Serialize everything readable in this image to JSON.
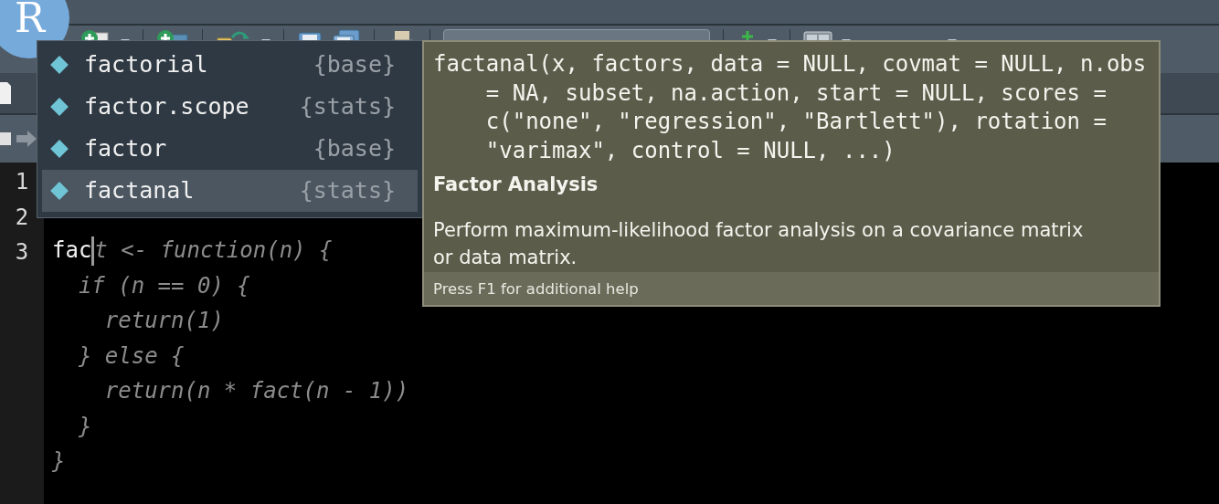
{
  "app": {
    "logo": "R"
  },
  "editor": {
    "lines": [
      {
        "number": "1"
      },
      {
        "number": "2"
      },
      {
        "number": "3",
        "typed": "fac",
        "rest": "t <- function(n) {",
        "cursor": true
      },
      {
        "rest": "  if (n == 0) {"
      },
      {
        "rest": "    return(1)"
      },
      {
        "rest": "  } else {"
      },
      {
        "rest": "    return(n * fact(n - 1))"
      },
      {
        "rest": "  }"
      },
      {
        "rest": "}"
      }
    ]
  },
  "completions": [
    {
      "name": "factorial",
      "package": "{base}",
      "selected": false
    },
    {
      "name": "factor.scope",
      "package": "{stats}",
      "selected": false
    },
    {
      "name": "factor",
      "package": "{base}",
      "selected": false
    },
    {
      "name": "factanal",
      "package": "{stats}",
      "selected": true
    }
  ],
  "help": {
    "signature": "factanal(x, factors, data = NULL, covmat = NULL, n.obs = NA, subset, na.action, start = NULL, scores = c(\"none\", \"regression\", \"Bartlett\"), rotation = \"varimax\", control = NULL, ...)",
    "title": "Factor Analysis",
    "description": "Perform maximum-likelihood factor analysis on a covariance matrix or data matrix.",
    "footer": "Press F1 for additional help"
  }
}
